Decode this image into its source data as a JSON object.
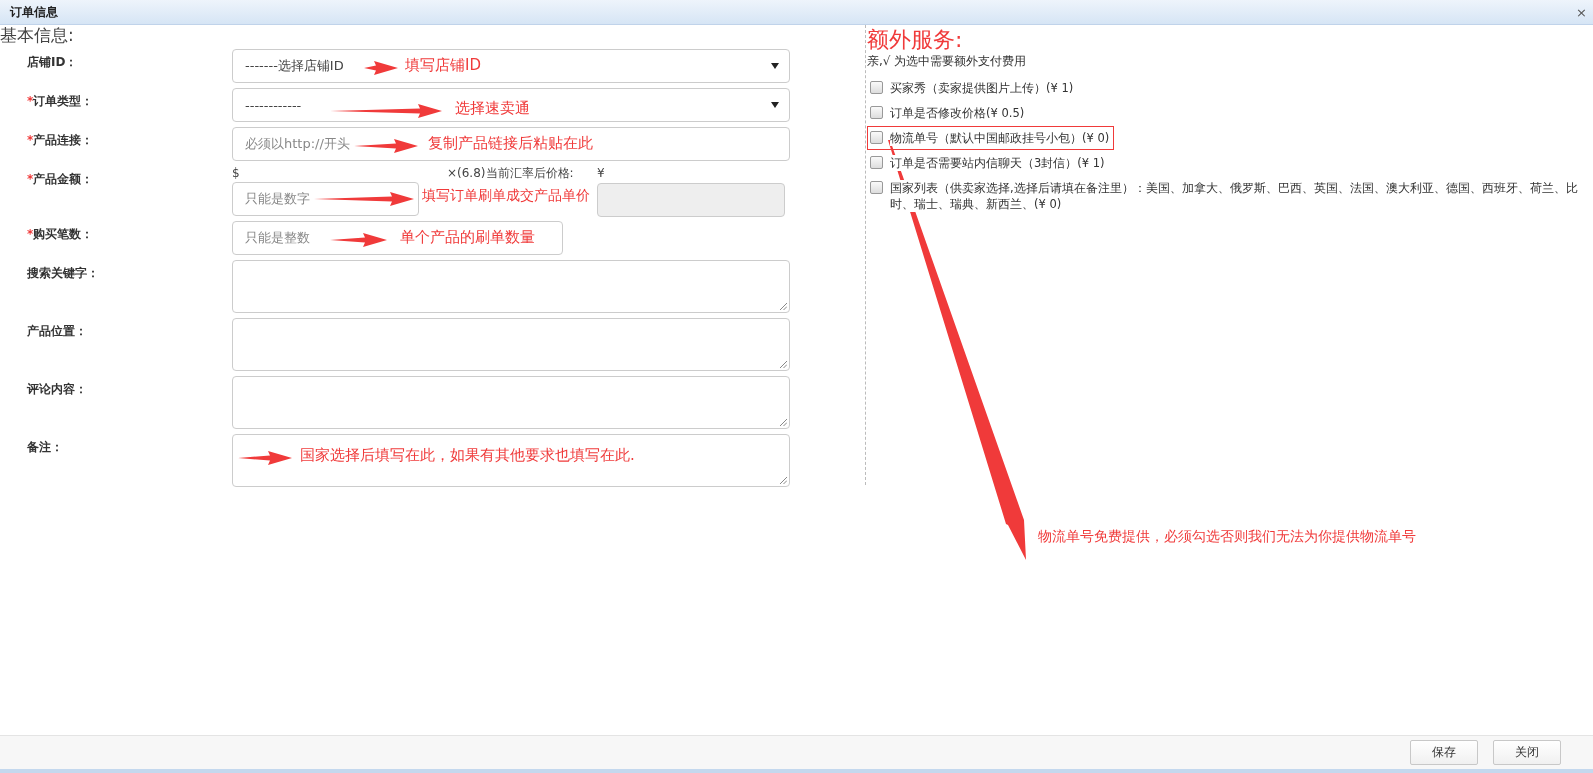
{
  "window": {
    "title": "订单信息",
    "close": "×"
  },
  "required_mark": "*",
  "basic": {
    "heading": "基本信息:",
    "fields": [
      {
        "kind": "select",
        "label": "店铺ID：",
        "required": false,
        "value": "-------选择店铺ID",
        "annotation": "填写店铺ID"
      },
      {
        "kind": "select",
        "label": "订单类型：",
        "required": true,
        "value": "------------",
        "annotation": "选择速卖通"
      },
      {
        "kind": "input",
        "label": "产品连接：",
        "required": true,
        "placeholder": "必须以http://开头",
        "annotation": "复制产品链接后粘贴在此"
      },
      {
        "kind": "amount",
        "label": "产品金额：",
        "required": true,
        "currency": "$",
        "placeholder": "只能是数字",
        "rate_text": "×(6.8)当前汇率后价格:",
        "converted_symbol": "¥",
        "converted_disabled": true,
        "annotation": "填写订单刷单成交产品单价"
      },
      {
        "kind": "short",
        "label": "购买笔数：",
        "required": true,
        "placeholder": "只能是整数",
        "annotation": "单个产品的刷单数量"
      },
      {
        "kind": "textarea",
        "label": "搜索关键字：",
        "required": false
      },
      {
        "kind": "textarea",
        "label": "产品位置：",
        "required": false
      },
      {
        "kind": "textarea",
        "label": "评论内容：",
        "required": false
      },
      {
        "kind": "textarea",
        "label": "备注：",
        "required": false,
        "annotation": "国家选择后填写在此，如果有其他要求也填写在此."
      }
    ]
  },
  "extra": {
    "heading": "额外服务:",
    "subtitle": "亲,√ 为选中需要额外支付费用",
    "note": "物流单号免费提供，必须勾选否则我们无法为你提供物流单号",
    "services": [
      {
        "lines": [
          "买家秀（卖家提供图片上传）(¥ 1)"
        ],
        "checked": false,
        "highlighted": false
      },
      {
        "lines": [
          "订单是否修改价格(¥ 0.5)"
        ],
        "checked": false,
        "highlighted": false
      },
      {
        "lines": [
          "物流单号（默认中国邮政挂号小包）(¥ 0)"
        ],
        "checked": false,
        "highlighted": true
      },
      {
        "lines": [
          "订单是否需要站内信聊天（3封信）(¥ 1)"
        ],
        "checked": false,
        "highlighted": false
      },
      {
        "lines": [
          "国家列表（供卖家选择,选择后请填在备注里）：美国、加拿大、俄罗斯、巴西、英国、法国、澳大利亚、德国、西班牙、荷兰、比",
          "时、瑞士、瑞典、新西兰、(¥ 0)"
        ],
        "checked": false,
        "highlighted": false
      }
    ]
  },
  "buttons": [
    "保存",
    "关闭"
  ]
}
